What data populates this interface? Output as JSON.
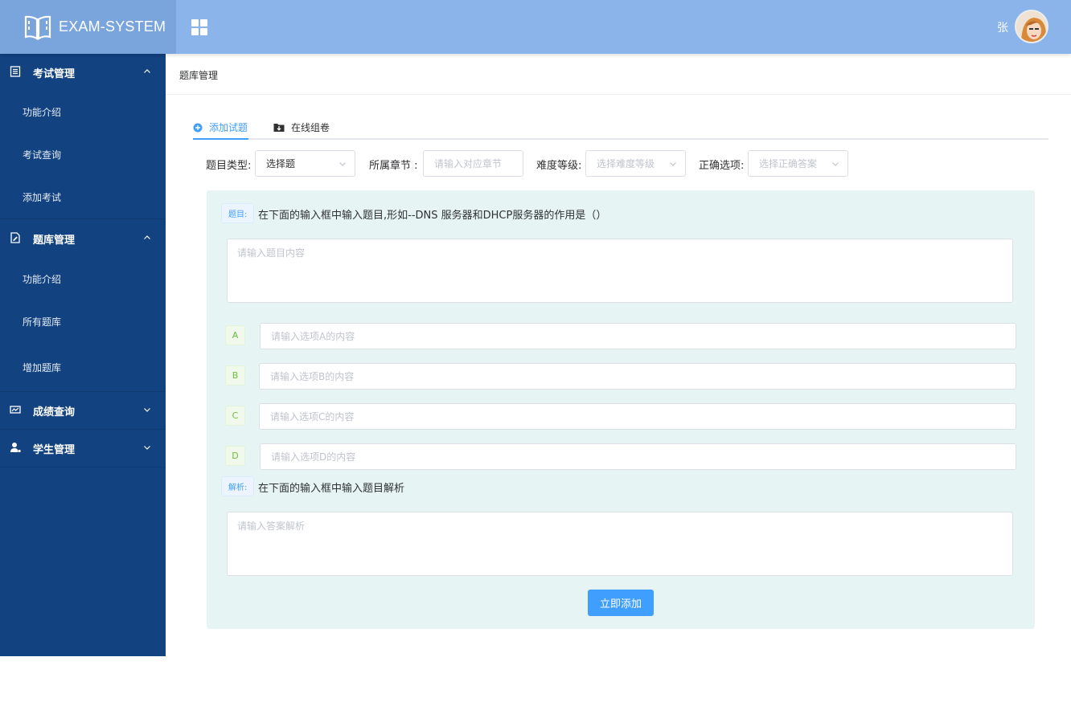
{
  "app": {
    "logo_text": "EXAM-SYSTEM",
    "user_name": "张",
    "colors": {
      "header": "#8ab4ea",
      "sidebar": "#124280",
      "primary": "#409eff",
      "panel": "#e6f4f4"
    }
  },
  "sidebar": {
    "groups": [
      {
        "label": "考试管理",
        "icon": "exam-list-icon",
        "expanded": true,
        "items": [
          "功能介绍",
          "考试查询",
          "添加考试"
        ]
      },
      {
        "label": "题库管理",
        "icon": "question-bank-icon",
        "expanded": true,
        "items": [
          "功能介绍",
          "所有题库",
          "增加题库"
        ]
      },
      {
        "label": "成绩查询",
        "icon": "score-chart-icon",
        "expanded": false,
        "items": []
      },
      {
        "label": "学生管理",
        "icon": "student-icon",
        "expanded": false,
        "items": []
      }
    ]
  },
  "breadcrumb": "题库管理",
  "tabs": [
    {
      "label": "添加试题",
      "icon": "plus-circle-icon",
      "active": true
    },
    {
      "label": "在线组卷",
      "icon": "folder-download-icon",
      "active": false
    }
  ],
  "filters": {
    "type_label": "题目类型:",
    "type_value": "选择题",
    "chapter_label": "所属章节 :",
    "chapter_placeholder": "请输入对应章节",
    "difficulty_label": "难度等级:",
    "difficulty_placeholder": "选择难度等级",
    "answer_label": "正确选项:",
    "answer_placeholder": "选择正确答案"
  },
  "form": {
    "question_tag": "题目:",
    "question_hint": "在下面的输入框中输入题目,形如--DNS 服务器和DHCP服务器的作用是（）",
    "question_placeholder": "请输入题目内容",
    "options": [
      {
        "key": "A",
        "placeholder": "请输入选项A的内容"
      },
      {
        "key": "B",
        "placeholder": "请输入选项B的内容"
      },
      {
        "key": "C",
        "placeholder": "请输入选项C的内容"
      },
      {
        "key": "D",
        "placeholder": "请输入选项D的内容"
      }
    ],
    "analysis_tag": "解析:",
    "analysis_hint": "在下面的输入框中输入题目解析",
    "analysis_placeholder": "请输入答案解析",
    "submit_label": "立即添加"
  }
}
